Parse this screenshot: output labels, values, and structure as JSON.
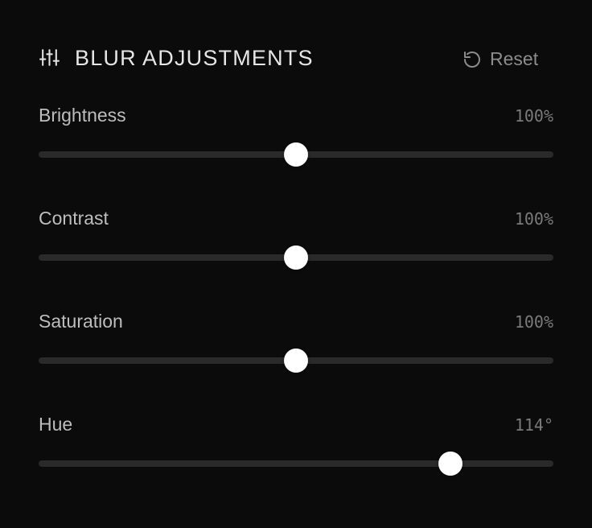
{
  "panel": {
    "title": "BLUR ADJUSTMENTS",
    "title_icon": "sliders-icon",
    "reset_label": "Reset",
    "reset_icon": "rotate-ccw-icon"
  },
  "colors": {
    "background": "#0b0b0b",
    "track": "#2a2a2a",
    "thumb": "#ffffff",
    "title_text": "#e6e6e6",
    "label_text": "#bdbdbd",
    "value_text": "#7a7a7a"
  },
  "controls": [
    {
      "id": "brightness",
      "label": "Brightness",
      "value": "100%",
      "position_fraction": 0.5
    },
    {
      "id": "contrast",
      "label": "Contrast",
      "value": "100%",
      "position_fraction": 0.5
    },
    {
      "id": "saturation",
      "label": "Saturation",
      "value": "100%",
      "position_fraction": 0.5
    },
    {
      "id": "hue",
      "label": "Hue",
      "value": "114°",
      "position_fraction": 0.8
    }
  ]
}
